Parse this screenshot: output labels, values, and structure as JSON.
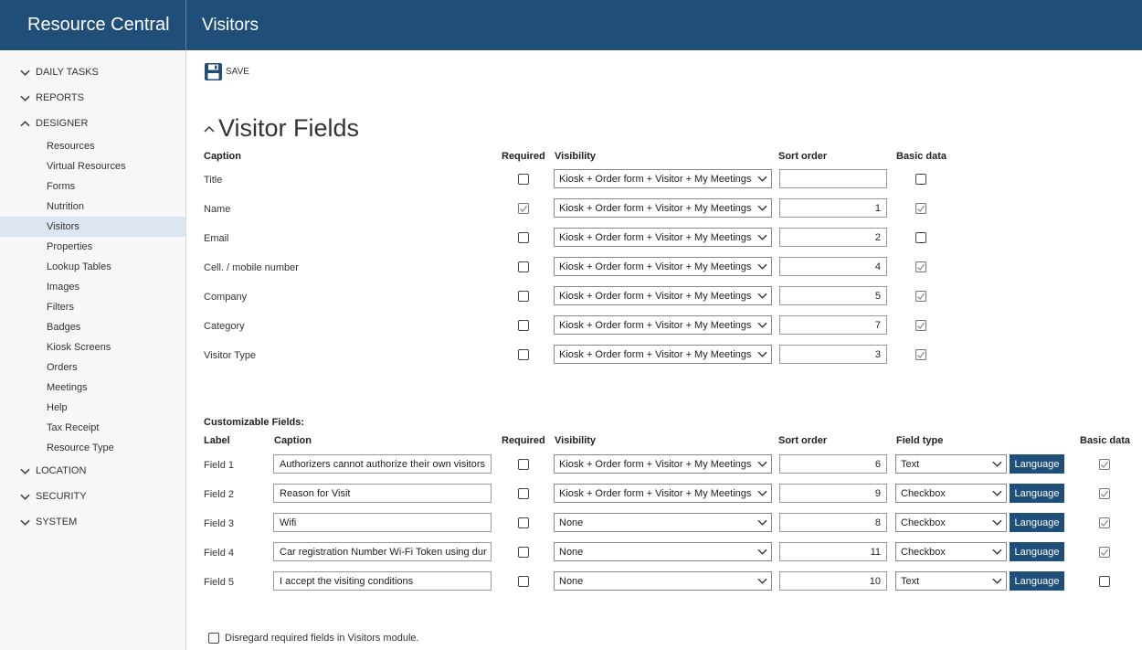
{
  "app": {
    "brand": "Resource Central",
    "page_title": "Visitors"
  },
  "sidebar": {
    "groups": [
      {
        "label": "DAILY TASKS",
        "expanded": false
      },
      {
        "label": "REPORTS",
        "expanded": false
      },
      {
        "label": "DESIGNER",
        "expanded": true
      },
      {
        "label": "LOCATION",
        "expanded": false
      },
      {
        "label": "SECURITY",
        "expanded": false
      },
      {
        "label": "SYSTEM",
        "expanded": false
      }
    ],
    "designer_items": [
      "Resources",
      "Virtual Resources",
      "Forms",
      "Nutrition",
      "Visitors",
      "Properties",
      "Lookup Tables",
      "Images",
      "Filters",
      "Badges",
      "Kiosk Screens",
      "Orders",
      "Meetings",
      "Help",
      "Tax Receipt",
      "Resource Type"
    ],
    "active_item": "Visitors"
  },
  "toolbar": {
    "save_label": "SAVE",
    "save_icon": "floppy-disk-icon"
  },
  "section": {
    "title": "Visitor Fields"
  },
  "visitor_fields": {
    "headers": {
      "caption": "Caption",
      "required": "Required",
      "visibility": "Visibility",
      "sort_order": "Sort order",
      "basic_data": "Basic data"
    },
    "rows": [
      {
        "caption": "Title",
        "required": false,
        "visibility": "Kiosk + Order form + Visitor + My Meetings",
        "sort_order": "",
        "basic_data": false
      },
      {
        "caption": "Name",
        "required": true,
        "visibility": "Kiosk + Order form + Visitor + My Meetings",
        "sort_order": "1",
        "basic_data": true
      },
      {
        "caption": "Email",
        "required": false,
        "visibility": "Kiosk + Order form + Visitor + My Meetings",
        "sort_order": "2",
        "basic_data": false
      },
      {
        "caption": "Cell. / mobile number",
        "required": false,
        "visibility": "Kiosk + Order form + Visitor + My Meetings",
        "sort_order": "4",
        "basic_data": true
      },
      {
        "caption": "Company",
        "required": false,
        "visibility": "Kiosk + Order form + Visitor + My Meetings",
        "sort_order": "5",
        "basic_data": true
      },
      {
        "caption": "Category",
        "required": false,
        "visibility": "Kiosk + Order form + Visitor + My Meetings",
        "sort_order": "7",
        "basic_data": true
      },
      {
        "caption": "Visitor Type",
        "required": false,
        "visibility": "Kiosk + Order form + Visitor + My Meetings",
        "sort_order": "3",
        "basic_data": true
      }
    ]
  },
  "custom_fields": {
    "title": "Customizable Fields:",
    "headers": {
      "label": "Label",
      "caption": "Caption",
      "required": "Required",
      "visibility": "Visibility",
      "sort_order": "Sort order",
      "field_type": "Field type",
      "basic_data": "Basic data"
    },
    "language_label": "Language",
    "rows": [
      {
        "label": "Field 1",
        "caption": "Authorizers cannot authorize their own visitors",
        "required": false,
        "visibility": "Kiosk + Order form + Visitor + My Meetings",
        "sort_order": "6",
        "field_type": "Text",
        "basic_data": true
      },
      {
        "label": "Field 2",
        "caption": "Reason for Visit",
        "required": false,
        "visibility": "Kiosk + Order form + Visitor + My Meetings",
        "sort_order": "9",
        "field_type": "Checkbox",
        "basic_data": true
      },
      {
        "label": "Field 3",
        "caption": "Wifi",
        "required": false,
        "visibility": "None",
        "sort_order": "8",
        "field_type": "Checkbox",
        "basic_data": true
      },
      {
        "label": "Field 4",
        "caption": "Car registration Number Wi-Fi Token using dur",
        "required": false,
        "visibility": "None",
        "sort_order": "11",
        "field_type": "Checkbox",
        "basic_data": true
      },
      {
        "label": "Field 5",
        "caption": "I accept the visiting conditions",
        "required": false,
        "visibility": "None",
        "sort_order": "10",
        "field_type": "Text",
        "basic_data": false
      }
    ]
  },
  "footer": {
    "disregard_label": "Disregard required fields in Visitors module.",
    "disregard_checked": false
  }
}
